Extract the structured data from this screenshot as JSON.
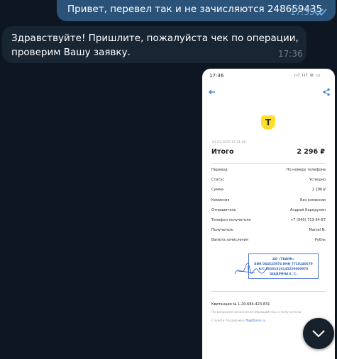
{
  "chat": {
    "outgoing": {
      "text": "Привет, перевел так и не зачисляются 248659435",
      "time": "17:35"
    },
    "incoming": {
      "line1": "Здравствуйте! Пришлите, пожалуйста чек по операции,",
      "line2": "проверим Вашу заявку.",
      "time": "17:36"
    }
  },
  "screenshot": {
    "status_time": "17:36",
    "status_icons": "ııl ııl ⊜ ▭",
    "logo_letter": "Т",
    "receipt": {
      "date": "01.03.2025  17:21:46",
      "total_label": "Итого",
      "total_value": "2 296 ₽",
      "rows": [
        {
          "label": "Перевод",
          "value": "По номеру телефона"
        },
        {
          "label": "Статус",
          "value": "Успешно"
        },
        {
          "label": "Сумма",
          "value": "2 296 ₽"
        },
        {
          "label": "Комиссия",
          "value": "Без комиссии"
        },
        {
          "label": "Отправитель",
          "value": "Андрей Бородулин"
        },
        {
          "label": "Телефон получателя",
          "value": "+7 (940) 713-64-87"
        },
        {
          "label": "Получатель",
          "value": "Marsel N."
        },
        {
          "label": "Валюта зачисления",
          "value": "Рубль"
        }
      ],
      "stamp": {
        "line1": "АО «ТБАНК»",
        "line2": "БИК 044525974 ИНН 7710140679",
        "line3": "К/С 30101810145250000974",
        "line4": "ШАДРИНА Е. С."
      },
      "receipt_number": "Квитанция  № 1-20-684-423-831",
      "note": "По вопросам зачисления обращайтесь к получателю",
      "support_prefix": "Служба поддержки ",
      "support_link": "fb@tbank.ru"
    }
  },
  "colors": {
    "background": "#0e1621",
    "outgoing_bubble": "#2b5278",
    "incoming_bubble": "#182533",
    "accent_yellow": "#ffdd2d",
    "link_blue": "#3b7bd4"
  }
}
